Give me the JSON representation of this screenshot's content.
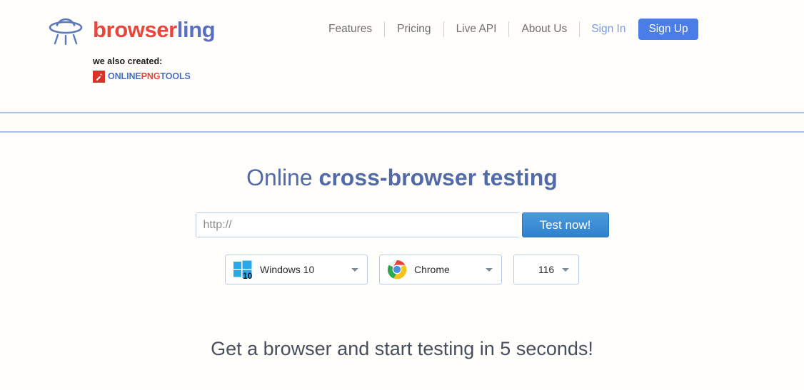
{
  "header": {
    "logo": {
      "icon": "ufo-icon",
      "word_red": "browser",
      "word_blue": "ling"
    },
    "also_created": {
      "label": "we also created:",
      "badge_icon": "wrench-icon",
      "part_online": "ONLINE",
      "part_png": "PNG",
      "part_tools": "TOOLS"
    },
    "nav": {
      "items": [
        {
          "label": "Features"
        },
        {
          "label": "Pricing"
        },
        {
          "label": "Live API"
        },
        {
          "label": "About Us"
        }
      ],
      "sign_in": "Sign In",
      "sign_up": "Sign Up"
    }
  },
  "main": {
    "headline_light": "Online",
    "headline_bold": "cross-browser testing",
    "url_field": {
      "value": "",
      "placeholder": "http://"
    },
    "test_button": "Test now!",
    "selects": {
      "os": {
        "label": "Windows 10",
        "icon": "windows-logo-icon"
      },
      "browser": {
        "label": "Chrome",
        "icon": "chrome-logo-icon"
      },
      "version": {
        "label": "116"
      }
    },
    "tagline": "Get a browser and start testing in 5 seconds!"
  },
  "colors": {
    "brand_red": "#e8453c",
    "brand_blue": "#5b6fc0",
    "accent_blue": "#4a7de8",
    "headline_blue": "#526aa8",
    "divider_blue": "#a8c3e4",
    "background": "#fffefb"
  }
}
